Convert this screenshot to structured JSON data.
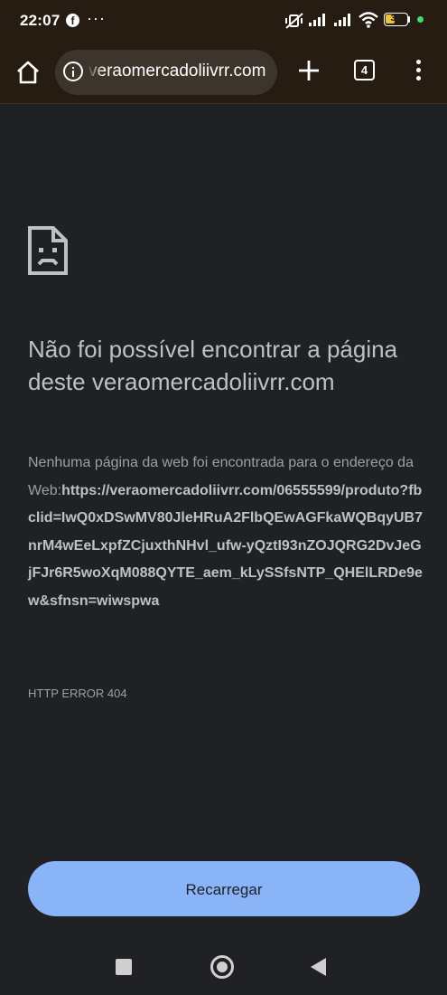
{
  "status_bar": {
    "time": "22:07",
    "notification_icon": "facebook-icon",
    "more": "···",
    "battery_level": "39",
    "icons": [
      "mute-vibrate-icon",
      "signal-icon",
      "signal-icon",
      "wifi-icon",
      "battery-icon"
    ]
  },
  "toolbar": {
    "url": "veraomercadoliivrr.com",
    "tab_count": "4",
    "icons": [
      "home-icon",
      "info-icon",
      "plus-icon",
      "tabs-icon",
      "more-vert-icon"
    ]
  },
  "error": {
    "title": "Não foi possível encontrar a página deste veraomercadoliivrr.com",
    "description_prefix": "Nenhuma página da web foi encontrada para o endereço da Web:",
    "url": "https://veraomercadoliivrr.com/06555599/produto?fbclid=IwQ0xDSwMV80JleHRuA2FlbQEwAGFkaWQBqyUB7nrM4wEeLxpfZCjuxthNHvl_ufw-yQztI93nZOJQRG2DvJeGjFJr6R5woXqM088QYTE_aem_kLySSfsNTP_QHElLRDe9ew&sfnsn=wiwspwa",
    "code": "HTTP ERROR 404",
    "reload_label": "Recarregar",
    "icon": "sad-page-icon"
  },
  "nav_bar": {
    "icons": [
      "recents-square-icon",
      "home-circle-icon",
      "back-triangle-icon"
    ]
  },
  "colors": {
    "background": "#202124",
    "toolbar": "#261c12",
    "button": "#8ab4f8",
    "battery": "#e8c43a"
  }
}
